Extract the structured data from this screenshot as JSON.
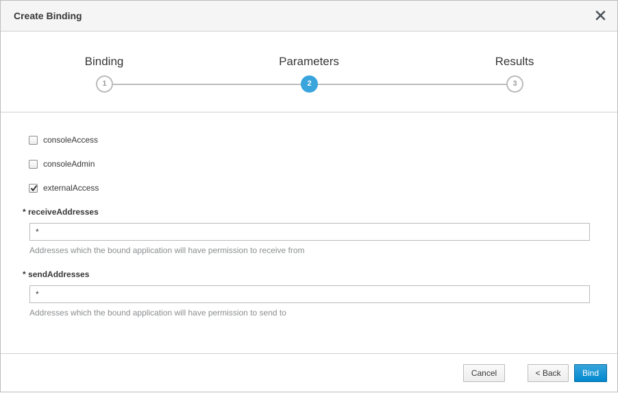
{
  "dialog": {
    "title": "Create Binding",
    "close_icon": "close-icon"
  },
  "wizard": {
    "steps": [
      {
        "label": "Binding",
        "number": "1",
        "active": false
      },
      {
        "label": "Parameters",
        "number": "2",
        "active": true
      },
      {
        "label": "Results",
        "number": "3",
        "active": false
      }
    ]
  },
  "form": {
    "checkboxes": [
      {
        "label": "consoleAccess",
        "checked": false
      },
      {
        "label": "consoleAdmin",
        "checked": false
      },
      {
        "label": "externalAccess",
        "checked": true
      }
    ],
    "receive": {
      "required_mark": "*",
      "label": "receiveAddresses",
      "value": "*",
      "help": "Addresses which the bound application will have permission to receive from"
    },
    "send": {
      "required_mark": "*",
      "label": "sendAddresses",
      "value": "*",
      "help": "Addresses which the bound application will have permission to send to"
    }
  },
  "footer": {
    "cancel_label": "Cancel",
    "back_label": "< Back",
    "bind_label": "Bind"
  },
  "colors": {
    "accent": "#39a5dc",
    "primary_button": "#0088ce",
    "border": "#d1d1d1",
    "text": "#363636",
    "muted_text": "#8b8d8f"
  }
}
